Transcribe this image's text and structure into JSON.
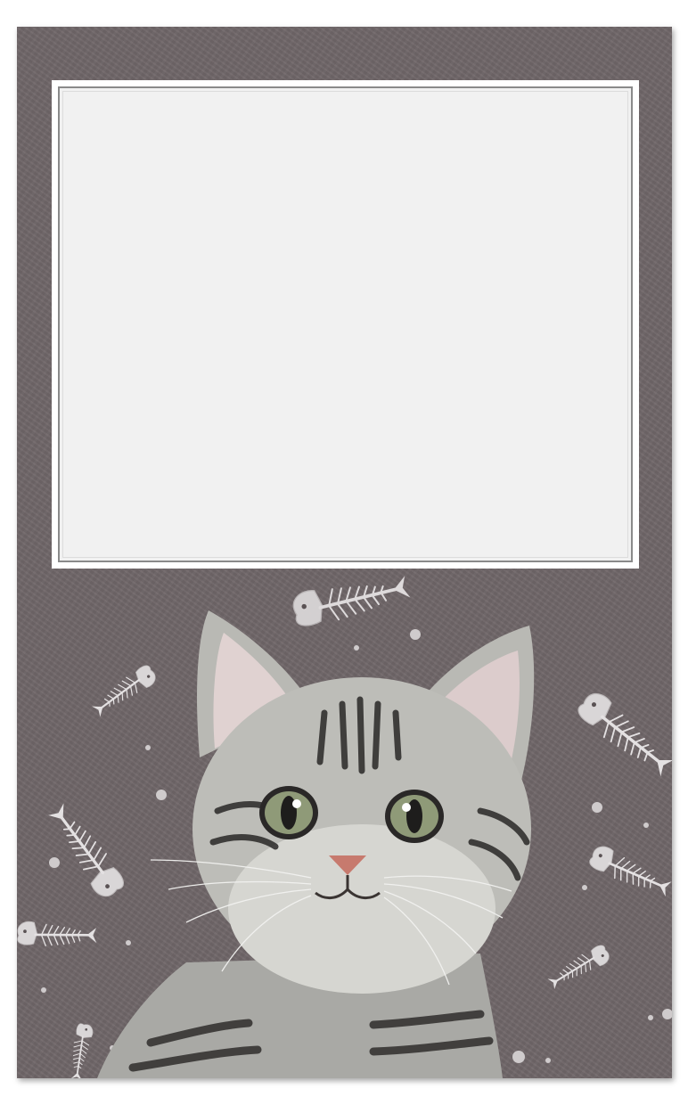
{
  "card": {
    "background_color": "#6f6668",
    "frame_color": "#ffffff",
    "photo_area_color": "#f1f1f1"
  },
  "decorations": {
    "cat": "tabby-kitten-illustration",
    "fish_bones": "fish-skeleton-icon",
    "bubbles": "bubble-dot"
  }
}
